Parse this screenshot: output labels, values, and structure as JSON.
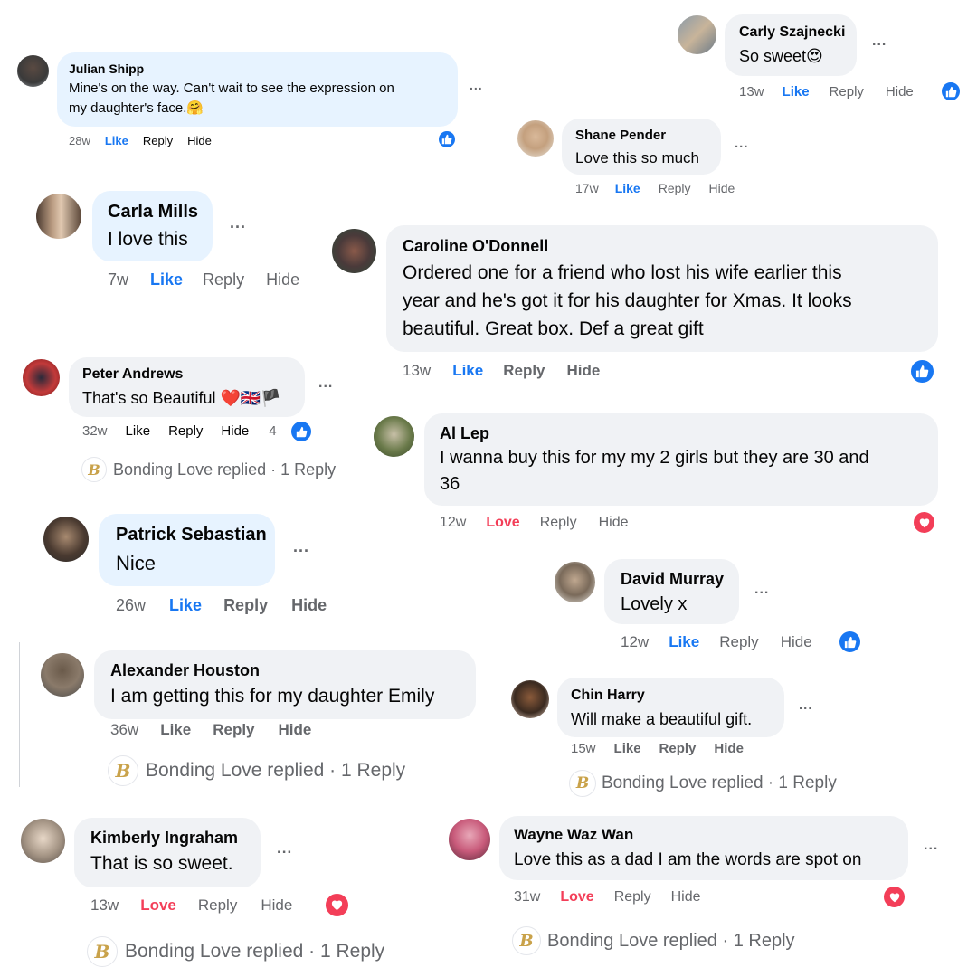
{
  "colors": {
    "like": "#1877f2",
    "love": "#f33e58",
    "bubble": "#f0f2f5",
    "highlight": "#e7f3ff",
    "muted": "#65676b"
  },
  "comments": [
    {
      "name": "Carly Szajnecki",
      "text": [
        "So sweet😍"
      ],
      "time": "13w",
      "like": "Like",
      "reply": "Reply",
      "hide": "Hide",
      "reaction_icon": "like-reaction-icon"
    },
    {
      "name": "Julian Shipp",
      "text": [
        "Mine's on the way. Can't wait to see the expression on",
        "my daughter's face.🤗"
      ],
      "time": "28w",
      "like": "Like",
      "reply": "Reply",
      "hide": "Hide",
      "reaction_icon": "like-reaction-icon"
    },
    {
      "name": "Shane Pender",
      "text": [
        "Love this so much"
      ],
      "time": "17w",
      "like": "Like",
      "reply": "Reply",
      "hide": "Hide"
    },
    {
      "name": "Carla Mills",
      "text": [
        "I love this"
      ],
      "time": "7w",
      "like": "Like",
      "reply": "Reply",
      "hide": "Hide"
    },
    {
      "name": "Caroline O'Donnell",
      "text": [
        "Ordered one for a friend who lost his wife earlier this",
        "year and he's got it for his daughter for Xmas. It looks",
        "beautiful. Great box. Def a great gift"
      ],
      "time": "13w",
      "like": "Like",
      "reply": "Reply",
      "hide": "Hide",
      "reaction_icon": "like-reaction-icon"
    },
    {
      "name": "Peter Andrews",
      "text": [
        "That's so Beautiful ❤️🇬🇧🏴"
      ],
      "time": "32w",
      "like": "Like",
      "reply": "Reply",
      "hide": "Hide",
      "reaction_count": "4",
      "replied": "Bonding Love replied · 1 Reply"
    },
    {
      "name": "Al Lep",
      "text": [
        "I wanna buy this for my my 2 girls but they are 30 and",
        "36"
      ],
      "time": "12w",
      "like": "Love",
      "reply": "Reply",
      "hide": "Hide",
      "reaction_icon": "love-reaction-icon"
    },
    {
      "name": "Patrick Sebastian",
      "text": [
        "Nice"
      ],
      "time": "26w",
      "like": "Like",
      "reply": "Reply",
      "hide": "Hide"
    },
    {
      "name": "David Murray",
      "text": [
        "Lovely x"
      ],
      "time": "12w",
      "like": "Like",
      "reply": "Reply",
      "hide": "Hide",
      "reaction_icon": "like-reaction-icon"
    },
    {
      "name": "Alexander Houston",
      "text": [
        "I am getting this for my daughter Emily"
      ],
      "time": "36w",
      "like": "Like",
      "reply": "Reply",
      "hide": "Hide",
      "replied": "Bonding Love replied · 1 Reply"
    },
    {
      "name": "Chin Harry",
      "text": [
        "Will make a beautiful gift."
      ],
      "time": "15w",
      "like": "Like",
      "reply": "Reply",
      "hide": "Hide",
      "replied": "Bonding Love replied · 1 Reply"
    },
    {
      "name": "Kimberly Ingraham",
      "text": [
        "That is so sweet."
      ],
      "time": "13w",
      "like": "Love",
      "reply": "Reply",
      "hide": "Hide",
      "reaction_icon": "love-reaction-icon",
      "replied": "Bonding Love replied · 1 Reply"
    },
    {
      "name": "Wayne Waz Wan",
      "text": [
        "Love this as a dad I am the words are spot on"
      ],
      "time": "31w",
      "like": "Love",
      "reply": "Reply",
      "hide": "Hide",
      "reaction_icon": "love-reaction-icon",
      "replied": "Bonding Love replied · 1 Reply"
    }
  ],
  "more_icon": "more-options-icon",
  "page_logo": "B",
  "ellipsis": "..."
}
